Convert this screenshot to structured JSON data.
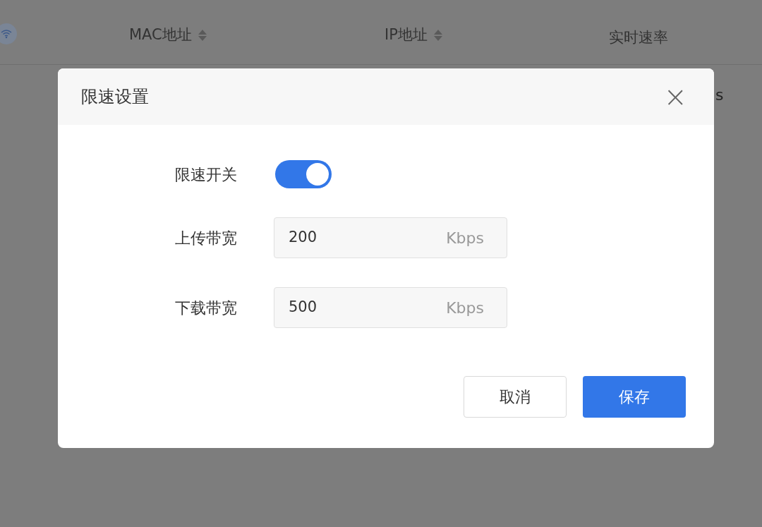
{
  "table": {
    "columns": [
      {
        "label": "MAC地址",
        "sortable": true
      },
      {
        "label": "IP地址",
        "sortable": true
      },
      {
        "label": "实时速率",
        "sortable": false
      }
    ],
    "row_fragment": "s"
  },
  "dialog": {
    "title": "限速设置",
    "close": "×",
    "fields": [
      {
        "kind": "toggle",
        "label": "限速开关",
        "on": true
      },
      {
        "kind": "input",
        "label": "上传带宽",
        "value": "200",
        "unit": "Kbps"
      },
      {
        "kind": "input",
        "label": "下载带宽",
        "value": "500",
        "unit": "Kbps"
      }
    ],
    "buttons": [
      {
        "label": "取消",
        "primary": false
      },
      {
        "label": "保存",
        "primary": true
      }
    ]
  }
}
